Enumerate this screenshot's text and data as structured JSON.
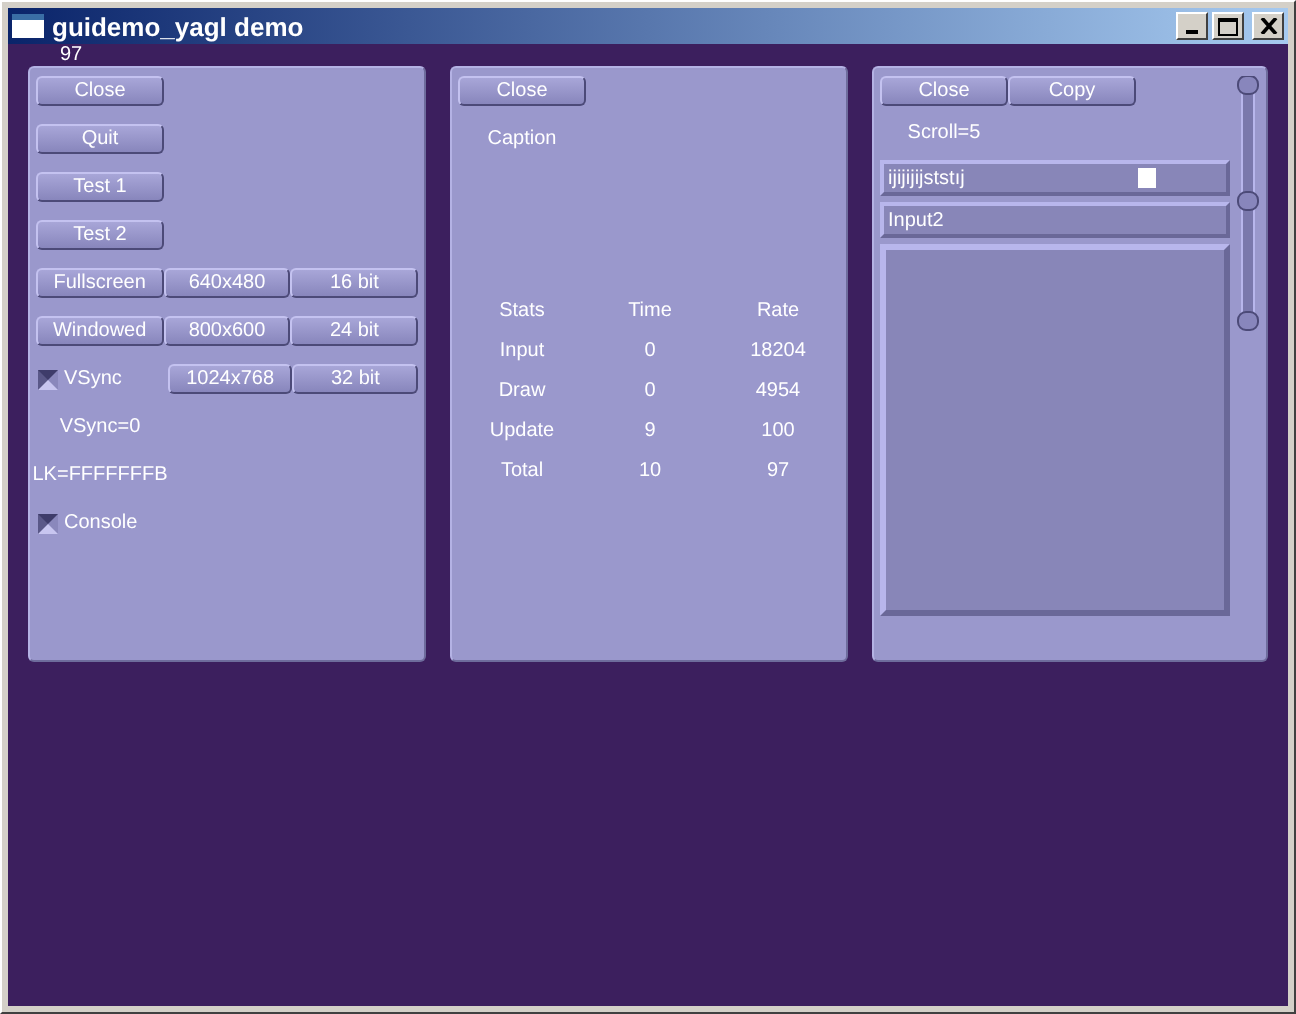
{
  "window": {
    "title": "guidemo_yagl demo"
  },
  "fps": "97",
  "left_panel": {
    "rows": [
      {
        "kind": "buttons",
        "items": [
          "Close"
        ]
      },
      {
        "kind": "buttons",
        "items": [
          "Quit"
        ]
      },
      {
        "kind": "buttons",
        "items": [
          "Test 1"
        ]
      },
      {
        "kind": "buttons",
        "items": [
          "Test 2"
        ]
      },
      {
        "kind": "buttons",
        "items": [
          "Fullscreen",
          "640x480",
          "16 bit"
        ]
      },
      {
        "kind": "buttons",
        "items": [
          "Windowed",
          "800x600",
          "24 bit"
        ]
      },
      {
        "kind": "checkbox",
        "label": "VSync",
        "checked": true,
        "items": [
          "1024x768",
          "32 bit"
        ]
      },
      {
        "kind": "label",
        "text": "VSync=0"
      },
      {
        "kind": "label",
        "text": "LK=FFFFFFFB"
      },
      {
        "kind": "checkbox",
        "label": "Console",
        "checked": true,
        "items": []
      }
    ]
  },
  "stats_panel": {
    "buttons": [
      "Close"
    ],
    "caption": "Caption",
    "columns": [
      "Stats",
      "Time",
      "Rate"
    ],
    "rows": [
      [
        "Input",
        "0",
        "18204"
      ],
      [
        "Draw",
        "0",
        "4954"
      ],
      [
        "Update",
        "9",
        "100"
      ],
      [
        "Total",
        "10",
        "97"
      ]
    ]
  },
  "edit_panel": {
    "buttons": [
      "Close",
      "Copy"
    ],
    "label": "Scroll=5",
    "inputs": [
      {
        "value": "ijijijijststıj",
        "cursor": true
      },
      {
        "value": "Input2",
        "cursor": false
      }
    ]
  }
}
